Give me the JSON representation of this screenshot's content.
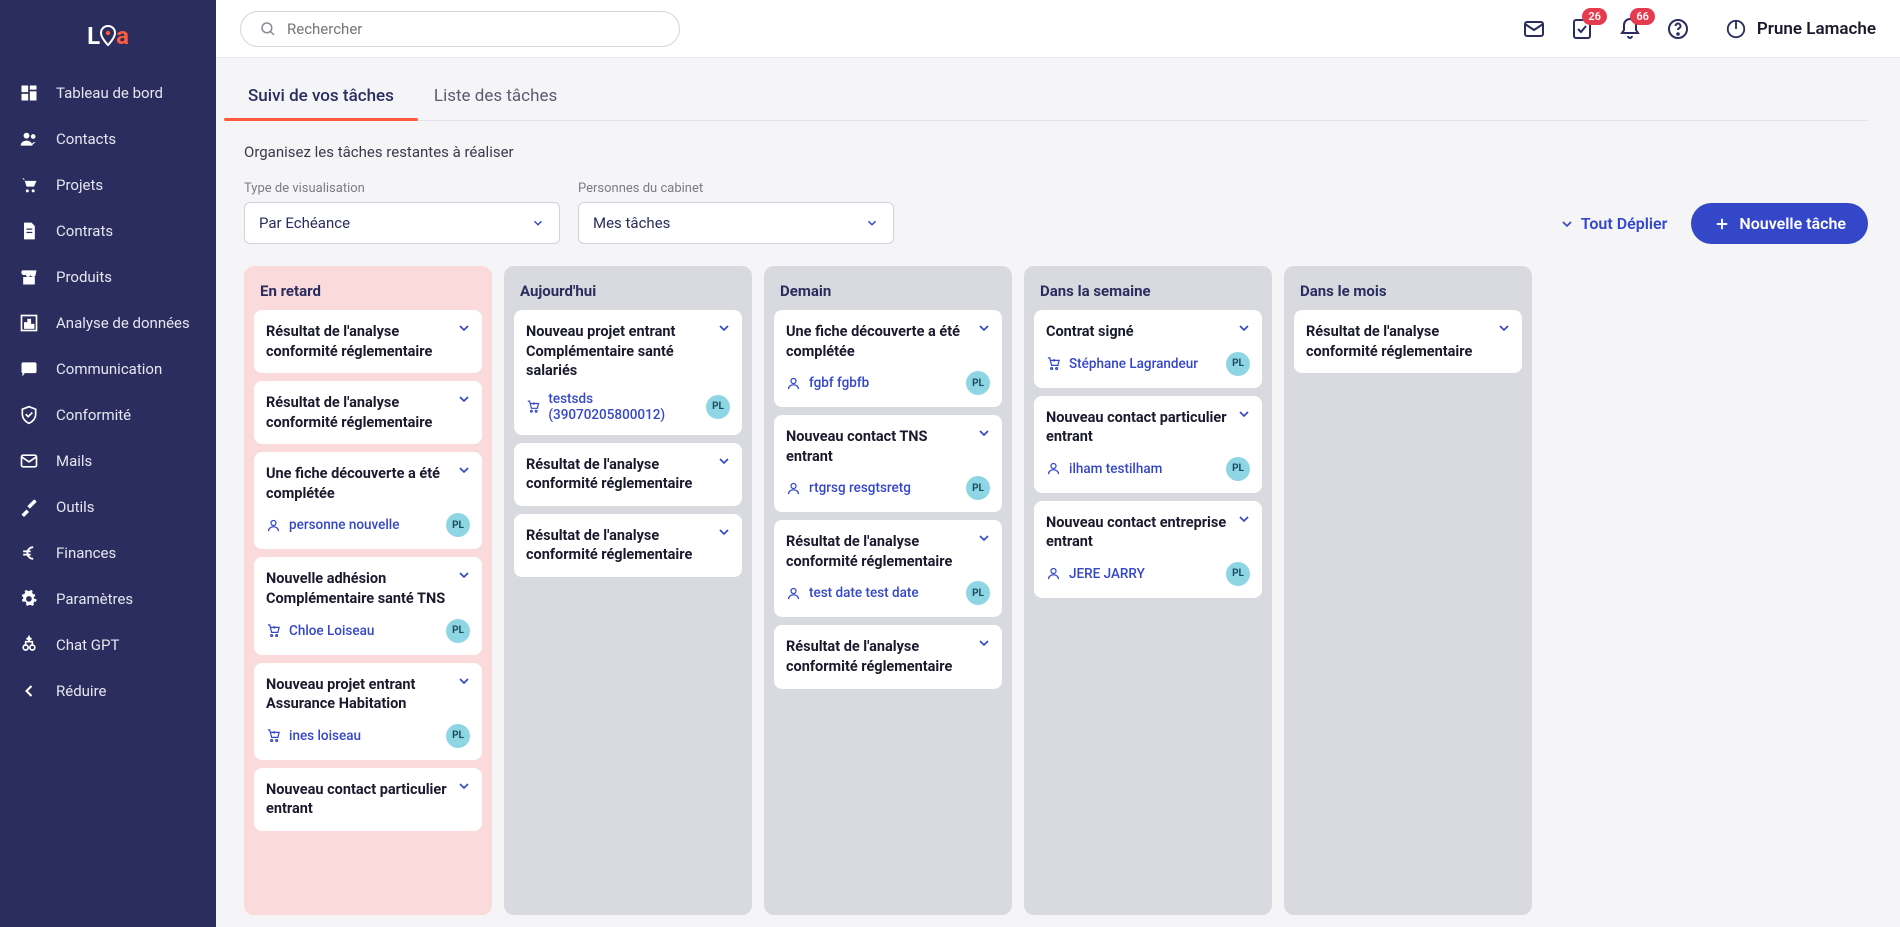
{
  "header": {
    "search_placeholder": "Rechercher",
    "tasks_badge": "26",
    "notif_badge": "66",
    "user_name": "Prune Lamache"
  },
  "sidebar": {
    "items": [
      {
        "label": "Tableau de bord",
        "icon": "dashboard"
      },
      {
        "label": "Contacts",
        "icon": "people"
      },
      {
        "label": "Projets",
        "icon": "cart"
      },
      {
        "label": "Contrats",
        "icon": "document"
      },
      {
        "label": "Produits",
        "icon": "store"
      },
      {
        "label": "Analyse de données",
        "icon": "chart"
      },
      {
        "label": "Communication",
        "icon": "chat"
      },
      {
        "label": "Conformité",
        "icon": "shield"
      },
      {
        "label": "Mails",
        "icon": "mail"
      },
      {
        "label": "Outils",
        "icon": "tools"
      },
      {
        "label": "Finances",
        "icon": "euro"
      },
      {
        "label": "Paramètres",
        "icon": "gear"
      },
      {
        "label": "Chat GPT",
        "icon": "spark"
      },
      {
        "label": "Réduire",
        "icon": "back"
      }
    ]
  },
  "tabs": {
    "active": "Suivi de vos tâches",
    "other": "Liste des tâches"
  },
  "subtitle": "Organisez les tâches restantes à réaliser",
  "filters": {
    "type_label": "Type de visualisation",
    "type_value": "Par Echéance",
    "people_label": "Personnes du cabinet",
    "people_value": "Mes tâches",
    "expand_all": "Tout Déplier",
    "new_task": "Nouvelle tâche"
  },
  "columns": [
    {
      "title": "En retard",
      "style": "late",
      "cards": [
        {
          "title": "Résultat de l'analyse conformité réglementaire"
        },
        {
          "title": "Résultat de l'analyse conformité réglementaire"
        },
        {
          "title": "Une fiche découverte a été complétée",
          "link_text": "personne nouvelle",
          "link_icon": "person",
          "avatar": "PL"
        },
        {
          "title": "Nouvelle adhésion Complémentaire santé TNS",
          "link_text": "Chloe Loiseau",
          "link_icon": "cart",
          "avatar": "PL"
        },
        {
          "title": "Nouveau projet entrant Assurance Habitation",
          "link_text": "ines loiseau",
          "link_icon": "cart",
          "avatar": "PL"
        },
        {
          "title": "Nouveau contact particulier entrant"
        }
      ]
    },
    {
      "title": "Aujourd'hui",
      "style": "normal",
      "cards": [
        {
          "title": "Nouveau projet entrant Complémentaire santé salariés",
          "link_text": "testsds (39070205800012)",
          "link_icon": "cart",
          "avatar": "PL"
        },
        {
          "title": "Résultat de l'analyse conformité réglementaire"
        },
        {
          "title": "Résultat de l'analyse conformité réglementaire"
        }
      ]
    },
    {
      "title": "Demain",
      "style": "normal",
      "cards": [
        {
          "title": "Une fiche découverte a été complétée",
          "link_text": "fgbf fgbfb",
          "link_icon": "person",
          "avatar": "PL"
        },
        {
          "title": "Nouveau contact TNS entrant",
          "link_text": "rtgrsg resgtsretg",
          "link_icon": "person",
          "avatar": "PL"
        },
        {
          "title": "Résultat de l'analyse conformité réglementaire",
          "link_text": "test date test date",
          "link_icon": "person",
          "avatar": "PL"
        },
        {
          "title": "Résultat de l'analyse conformité réglementaire"
        }
      ]
    },
    {
      "title": "Dans la semaine",
      "style": "normal",
      "cards": [
        {
          "title": "Contrat signé",
          "link_text": "Stéphane Lagrandeur",
          "link_icon": "cart",
          "avatar": "PL"
        },
        {
          "title": "Nouveau contact particulier entrant",
          "link_text": "ilham testilham",
          "link_icon": "person",
          "avatar": "PL"
        },
        {
          "title": "Nouveau contact entreprise entrant",
          "link_text": "JERE JARRY",
          "link_icon": "person",
          "avatar": "PL"
        }
      ]
    },
    {
      "title": "Dans le mois",
      "style": "normal",
      "cards": [
        {
          "title": "Résultat de l'analyse conformité réglementaire"
        }
      ]
    }
  ]
}
